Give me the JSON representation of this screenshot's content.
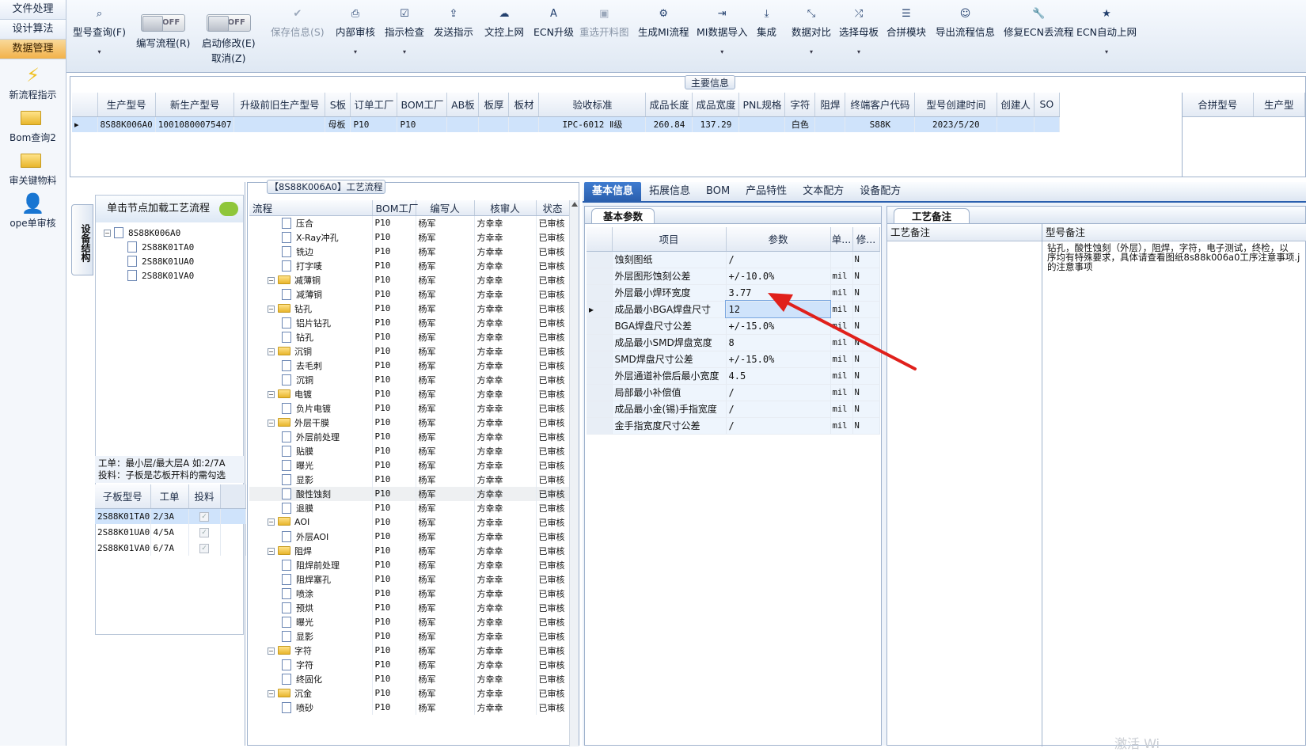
{
  "nav": {
    "buttons": [
      "文件处理",
      "设计算法",
      "数据管理"
    ],
    "icons": [
      {
        "icon": "lightning-icon",
        "label": "新流程指示"
      },
      {
        "icon": "folder-icon",
        "label": "Bom查询2"
      },
      {
        "icon": "folder-icon",
        "label": "审关键物料"
      },
      {
        "icon": "user-icon",
        "label": "ope单审核"
      }
    ]
  },
  "toolbar": {
    "items": [
      {
        "label": "型号查询(F)",
        "icon": "search-icon",
        "glyph": "⌕"
      },
      {
        "label": "编写流程(R)",
        "toggle": "OFF"
      },
      {
        "label": "启动修改(E)",
        "sub": "取消(Z)",
        "toggle": "OFF"
      },
      {
        "label": "保存信息(S)",
        "icon": "check-icon",
        "glyph": "✔"
      },
      {
        "label": "内部审核",
        "icon": "print-icon",
        "glyph": "⎙"
      },
      {
        "label": "指示检查",
        "icon": "checkbox-icon",
        "glyph": "☑"
      },
      {
        "label": "发送指示",
        "icon": "upload-icon",
        "glyph": "⇪"
      },
      {
        "label": "文控上网",
        "icon": "cloud-icon",
        "glyph": "☁"
      },
      {
        "label": "ECN升级",
        "icon": "font-icon",
        "glyph": "A"
      },
      {
        "label": "重选开料图",
        "icon": "image-icon",
        "glyph": "▣"
      },
      {
        "label": "生成MI流程",
        "icon": "gears-icon",
        "glyph": "⚙"
      },
      {
        "label": "MI数据导入",
        "icon": "import-icon",
        "glyph": "⇥"
      },
      {
        "label": "集成",
        "icon": "download-icon",
        "glyph": "⤓"
      },
      {
        "label": "数据对比",
        "icon": "compress-icon",
        "glyph": "⤡"
      },
      {
        "label": "选择母板",
        "icon": "shuffle-icon",
        "glyph": "⤮"
      },
      {
        "label": "合拼模块",
        "icon": "list-icon",
        "glyph": "☰"
      },
      {
        "label": "导出流程信息",
        "icon": "smile-icon",
        "glyph": "☺"
      },
      {
        "label": "修复ECN丢流程",
        "icon": "wrench-icon",
        "glyph": "🔧"
      },
      {
        "label": "ECN自动上网",
        "icon": "star-icon",
        "glyph": "★"
      }
    ]
  },
  "main_info": {
    "title": "主要信息",
    "headers": [
      "生产型号",
      "新生产型号",
      "升级前旧生产型号",
      "S板",
      "订单工厂",
      "BOM工厂",
      "AB板",
      "板厚",
      "板材",
      "验收标准",
      "成品长度",
      "成品宽度",
      "PNL规格",
      "字符",
      "阻焊",
      "终端客户代码",
      "型号创建时间",
      "创建人",
      "SO"
    ],
    "row": [
      "8S88K006A0",
      "10010800075407",
      "",
      "母板",
      "P10",
      "P10",
      "",
      "",
      "",
      "IPC-6012 Ⅱ级",
      "260.84",
      "137.29",
      "",
      "白色",
      "",
      "S88K",
      "2023/5/20",
      "",
      ""
    ],
    "right_headers": [
      "合拼型号",
      "生产型"
    ]
  },
  "left_panel": {
    "vtab": "设备结构",
    "hint": "单击节点加载工艺流程",
    "tree": {
      "root": "8S88K006A0",
      "children": [
        "2S88K01TA0",
        "2S88K01UA0",
        "2S88K01VA0"
      ]
    },
    "note1": "工单：最小层/最大层A 如:2/7A",
    "note2": "投料：子板是芯板开料的需勾选",
    "sub_headers": [
      "子板型号",
      "工单",
      "投料"
    ],
    "sub_rows": [
      [
        "2S88K01TA0",
        "2/3A"
      ],
      [
        "2S88K01UA0",
        "4/5A"
      ],
      [
        "2S88K01VA0",
        "6/7A"
      ]
    ]
  },
  "process": {
    "title": "【8S88K006A0】工艺流程",
    "headers": [
      "流程",
      "BOM工厂",
      "编写人",
      "核审人",
      "状态"
    ],
    "rows": [
      {
        "n": "压合",
        "l": 2
      },
      {
        "n": "X-Ray冲孔",
        "l": 2
      },
      {
        "n": "铣边",
        "l": 2
      },
      {
        "n": "打字唛",
        "l": 2
      },
      {
        "n": "减薄铜",
        "l": 1
      },
      {
        "n": "减薄铜",
        "l": 2
      },
      {
        "n": "钻孔",
        "l": 1
      },
      {
        "n": "铝片钻孔",
        "l": 2
      },
      {
        "n": "钻孔",
        "l": 2
      },
      {
        "n": "沉铜",
        "l": 1
      },
      {
        "n": "去毛刺",
        "l": 2
      },
      {
        "n": "沉铜",
        "l": 2
      },
      {
        "n": "电镀",
        "l": 1
      },
      {
        "n": "负片电镀",
        "l": 2
      },
      {
        "n": "外层干膜",
        "l": 1
      },
      {
        "n": "外层前处理",
        "l": 2
      },
      {
        "n": "贴膜",
        "l": 2
      },
      {
        "n": "曝光",
        "l": 2
      },
      {
        "n": "显影",
        "l": 2
      },
      {
        "n": "酸性蚀刻",
        "l": 2,
        "sel": true
      },
      {
        "n": "退膜",
        "l": 2
      },
      {
        "n": "AOI",
        "l": 1
      },
      {
        "n": "外层AOI",
        "l": 2
      },
      {
        "n": "阻焊",
        "l": 1
      },
      {
        "n": "阻焊前处理",
        "l": 2
      },
      {
        "n": "阻焊塞孔",
        "l": 2
      },
      {
        "n": "喷涂",
        "l": 2
      },
      {
        "n": "预烘",
        "l": 2
      },
      {
        "n": "曝光",
        "l": 2
      },
      {
        "n": "显影",
        "l": 2
      },
      {
        "n": "字符",
        "l": 1
      },
      {
        "n": "字符",
        "l": 2
      },
      {
        "n": "终固化",
        "l": 2
      },
      {
        "n": "沉金",
        "l": 1
      },
      {
        "n": "喷砂",
        "l": 2
      }
    ],
    "factory": "P10",
    "writer": "杨军",
    "checker": "方幸幸",
    "status": "已审核"
  },
  "tabs": [
    "基本信息",
    "拓展信息",
    "BOM",
    "产品特性",
    "文本配方",
    "设备配方"
  ],
  "basic": {
    "title": "基本参数",
    "headers": [
      "项目",
      "参数",
      "单...",
      "修..."
    ],
    "rows": [
      [
        "蚀刻图纸",
        "/",
        "",
        "N"
      ],
      [
        "外层图形蚀刻公差",
        "+/-10.0%",
        "mil",
        "N"
      ],
      [
        "外层最小焊环宽度",
        "3.77",
        "mil",
        "N"
      ],
      [
        "成品最小BGA焊盘尺寸",
        "12",
        "mil",
        "N"
      ],
      [
        "BGA焊盘尺寸公差",
        "+/-15.0%",
        "mil",
        "N"
      ],
      [
        "成品最小SMD焊盘宽度",
        "8",
        "mil",
        "N"
      ],
      [
        "SMD焊盘尺寸公差",
        "+/-15.0%",
        "mil",
        "N"
      ],
      [
        "外层通道补偿后最小宽度",
        "4.5",
        "mil",
        "N"
      ],
      [
        "局部最小补偿值",
        "/",
        "mil",
        "N"
      ],
      [
        "成品最小金(锡)手指宽度",
        "/",
        "mil",
        "N"
      ],
      [
        "金手指宽度尺寸公差",
        "/",
        "mil",
        "N"
      ]
    ]
  },
  "remarks": {
    "title": "工艺备注",
    "col1": "工艺备注",
    "col2": "型号备注",
    "text1": "钻孔，酸性蚀刻（外层），阻焊，字符，电子测试，终检，以",
    "text2": "序均有特殊要求，具体请查看图纸8s88k006a0工序注意事项.j",
    "text3": "的注意事项"
  },
  "watermark": "激活 Wi",
  "colors": {
    "accent": "#2a5fae",
    "selected": "#cfe3fb",
    "arrow": "#e0201b"
  }
}
